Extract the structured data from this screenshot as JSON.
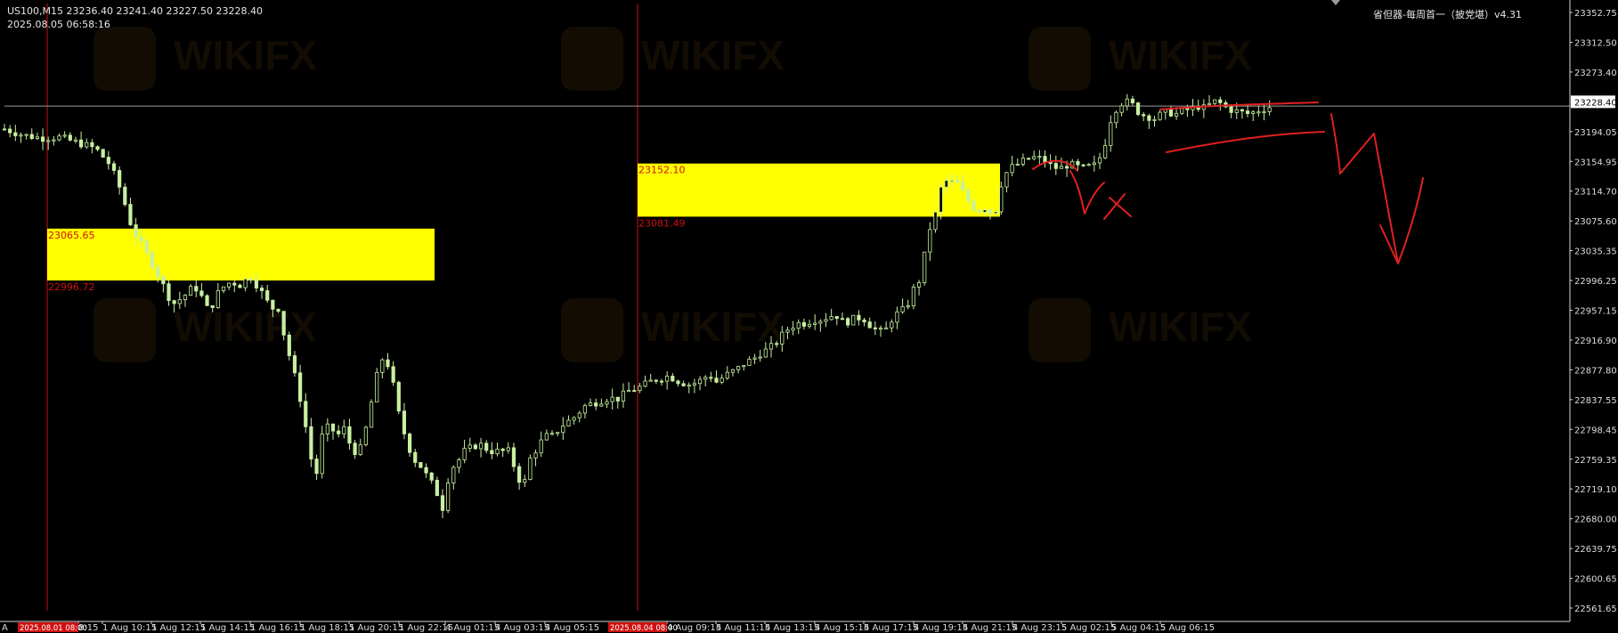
{
  "header": {
    "symbol": "US100,M15",
    "ohlc": "23236.40 23241.40 23227.50 23228.40",
    "datetime": "2025.08.05 06:58:16",
    "indicator": "省但器-每周首一（披党堪）v4.31"
  },
  "watermark": {
    "text": "WIKIFX"
  },
  "colors": {
    "background": "#000000",
    "candle": "#c8f0a0",
    "zone": "#ffff00",
    "zone_label": "#d01010",
    "separator": "#cc1010",
    "drawing": "#e02020",
    "axis_text": "#dcdcdc",
    "price_line": "#9a9a9a"
  },
  "chart_data": {
    "type": "candlestick",
    "symbol": "US100",
    "timeframe": "M15",
    "ylim": [
      22561.65,
      23370
    ],
    "y_ticks": [
      "23352.75",
      "23312.50",
      "23273.40",
      "23228.40",
      "23194.05",
      "23154.95",
      "23114.70",
      "23075.60",
      "23035.35",
      "22996.25",
      "22957.15",
      "22916.90",
      "22877.80",
      "22837.55",
      "22798.45",
      "22759.35",
      "22719.10",
      "22680.00",
      "22639.75",
      "22600.65",
      "22561.65"
    ],
    "current_price": "23228.40",
    "x_labels": [
      "8:15",
      "1 Aug 10:15",
      "1 Aug 12:15",
      "1 Aug 14:15",
      "1 Aug 16:15",
      "1 Aug 18:15",
      "1 Aug 20:15",
      "1 Aug 22:15",
      "4 Aug 01:15",
      "4 Aug 03:15",
      "4 Aug 05:15",
      "4 Aug 09:15",
      "4 Aug 11:15",
      "4 Aug 13:15",
      "4 Aug 15:15",
      "4 Aug 17:15",
      "4 Aug 19:15",
      "4 Aug 21:15",
      "4 Aug 23:15",
      "5 Aug 02:15",
      "5 Aug 04:15",
      "5 Aug 06:15"
    ],
    "x_label_first": "A",
    "separator_labels": [
      "2025.08.01 08:00",
      "2025.08.04 08:00"
    ],
    "zones": [
      {
        "high": 23065.65,
        "low": 22996.72,
        "high_label": "23065.65",
        "low_label": "22996.72"
      },
      {
        "high": 23152.1,
        "low": 23081.49,
        "high_label": "23152.10",
        "low_label": "23081.49"
      }
    ],
    "close_path": [
      [
        0,
        23198
      ],
      [
        10,
        23190
      ],
      [
        20,
        23186
      ],
      [
        30,
        23187
      ],
      [
        40,
        23180
      ],
      [
        50,
        23172
      ],
      [
        58,
        23150
      ],
      [
        64,
        23115
      ],
      [
        70,
        23065
      ],
      [
        76,
        23040
      ],
      [
        82,
        23015
      ],
      [
        88,
        22985
      ],
      [
        92,
        22965
      ],
      [
        98,
        22975
      ],
      [
        104,
        22990
      ],
      [
        108,
        22975
      ],
      [
        112,
        22955
      ],
      [
        118,
        22985
      ],
      [
        124,
        22995
      ],
      [
        130,
        22990
      ],
      [
        134,
        23005
      ],
      [
        140,
        22985
      ],
      [
        146,
        22960
      ],
      [
        150,
        22960
      ],
      [
        154,
        22915
      ],
      [
        158,
        22880
      ],
      [
        162,
        22840
      ],
      [
        166,
        22790
      ],
      [
        168,
        22760
      ],
      [
        170,
        22725
      ],
      [
        174,
        22790
      ],
      [
        178,
        22805
      ],
      [
        182,
        22790
      ],
      [
        186,
        22800
      ],
      [
        190,
        22775
      ],
      [
        194,
        22765
      ],
      [
        198,
        22800
      ],
      [
        204,
        22870
      ],
      [
        208,
        22900
      ],
      [
        212,
        22870
      ],
      [
        216,
        22820
      ],
      [
        220,
        22785
      ],
      [
        224,
        22760
      ],
      [
        228,
        22750
      ],
      [
        232,
        22735
      ],
      [
        236,
        22720
      ],
      [
        240,
        22695
      ],
      [
        244,
        22745
      ],
      [
        248,
        22755
      ],
      [
        252,
        22770
      ],
      [
        256,
        22775
      ],
      [
        260,
        22780
      ],
      [
        266,
        22770
      ],
      [
        270,
        22770
      ],
      [
        276,
        22770
      ],
      [
        280,
        22745
      ],
      [
        284,
        22720
      ],
      [
        288,
        22760
      ],
      [
        292,
        22775
      ],
      [
        296,
        22790
      ],
      [
        300,
        22790
      ],
      [
        306,
        22805
      ],
      [
        312,
        22815
      ],
      [
        318,
        22830
      ],
      [
        324,
        22835
      ],
      [
        330,
        22840
      ],
      [
        336,
        22840
      ],
      [
        342,
        22850
      ],
      [
        348,
        22855
      ],
      [
        356,
        22865
      ],
      [
        364,
        22870
      ],
      [
        370,
        22862
      ],
      [
        376,
        22858
      ],
      [
        382,
        22865
      ],
      [
        386,
        22872
      ],
      [
        390,
        22862
      ],
      [
        396,
        22872
      ],
      [
        402,
        22880
      ],
      [
        406,
        22888
      ],
      [
        410,
        22892
      ],
      [
        414,
        22900
      ],
      [
        418,
        22905
      ],
      [
        422,
        22912
      ],
      [
        428,
        22930
      ],
      [
        434,
        22940
      ],
      [
        438,
        22940
      ],
      [
        444,
        22945
      ],
      [
        448,
        22945
      ],
      [
        452,
        22950
      ],
      [
        456,
        22950
      ],
      [
        460,
        22940
      ],
      [
        464,
        22945
      ],
      [
        470,
        22948
      ],
      [
        474,
        22938
      ],
      [
        478,
        22930
      ],
      [
        482,
        22928
      ],
      [
        486,
        22945
      ],
      [
        490,
        22955
      ],
      [
        494,
        22960
      ],
      [
        498,
        22985
      ],
      [
        502,
        23000
      ],
      [
        506,
        23060
      ],
      [
        510,
        23085
      ],
      [
        514,
        23130
      ],
      [
        518,
        23128
      ],
      [
        522,
        23125
      ],
      [
        526,
        23110
      ],
      [
        530,
        23095
      ],
      [
        534,
        23090
      ],
      [
        538,
        23095
      ],
      [
        542,
        23080
      ],
      [
        546,
        23125
      ],
      [
        550,
        23145
      ],
      [
        554,
        23150
      ],
      [
        558,
        23155
      ],
      [
        562,
        23160
      ],
      [
        566,
        23160
      ],
      [
        570,
        23155
      ],
      [
        574,
        23148
      ],
      [
        578,
        23145
      ],
      [
        582,
        23150
      ],
      [
        586,
        23150
      ],
      [
        590,
        23145
      ],
      [
        594,
        23148
      ],
      [
        598,
        23150
      ],
      [
        602,
        23170
      ],
      [
        606,
        23210
      ],
      [
        610,
        23230
      ],
      [
        614,
        23235
      ],
      [
        618,
        23230
      ],
      [
        622,
        23218
      ],
      [
        626,
        23215
      ],
      [
        630,
        23212
      ],
      [
        634,
        23218
      ],
      [
        638,
        23220
      ],
      [
        642,
        23218
      ],
      [
        646,
        23222
      ],
      [
        650,
        23225
      ],
      [
        654,
        23228
      ],
      [
        658,
        23225
      ],
      [
        662,
        23235
      ],
      [
        666,
        23232
      ],
      [
        670,
        23225
      ],
      [
        674,
        23222
      ],
      [
        678,
        23220
      ],
      [
        682,
        23218
      ],
      [
        686,
        23222
      ],
      [
        690,
        23225
      ],
      [
        694,
        23228
      ]
    ],
    "grid": false,
    "projection": "hand-drawn red arrow pointing down"
  }
}
